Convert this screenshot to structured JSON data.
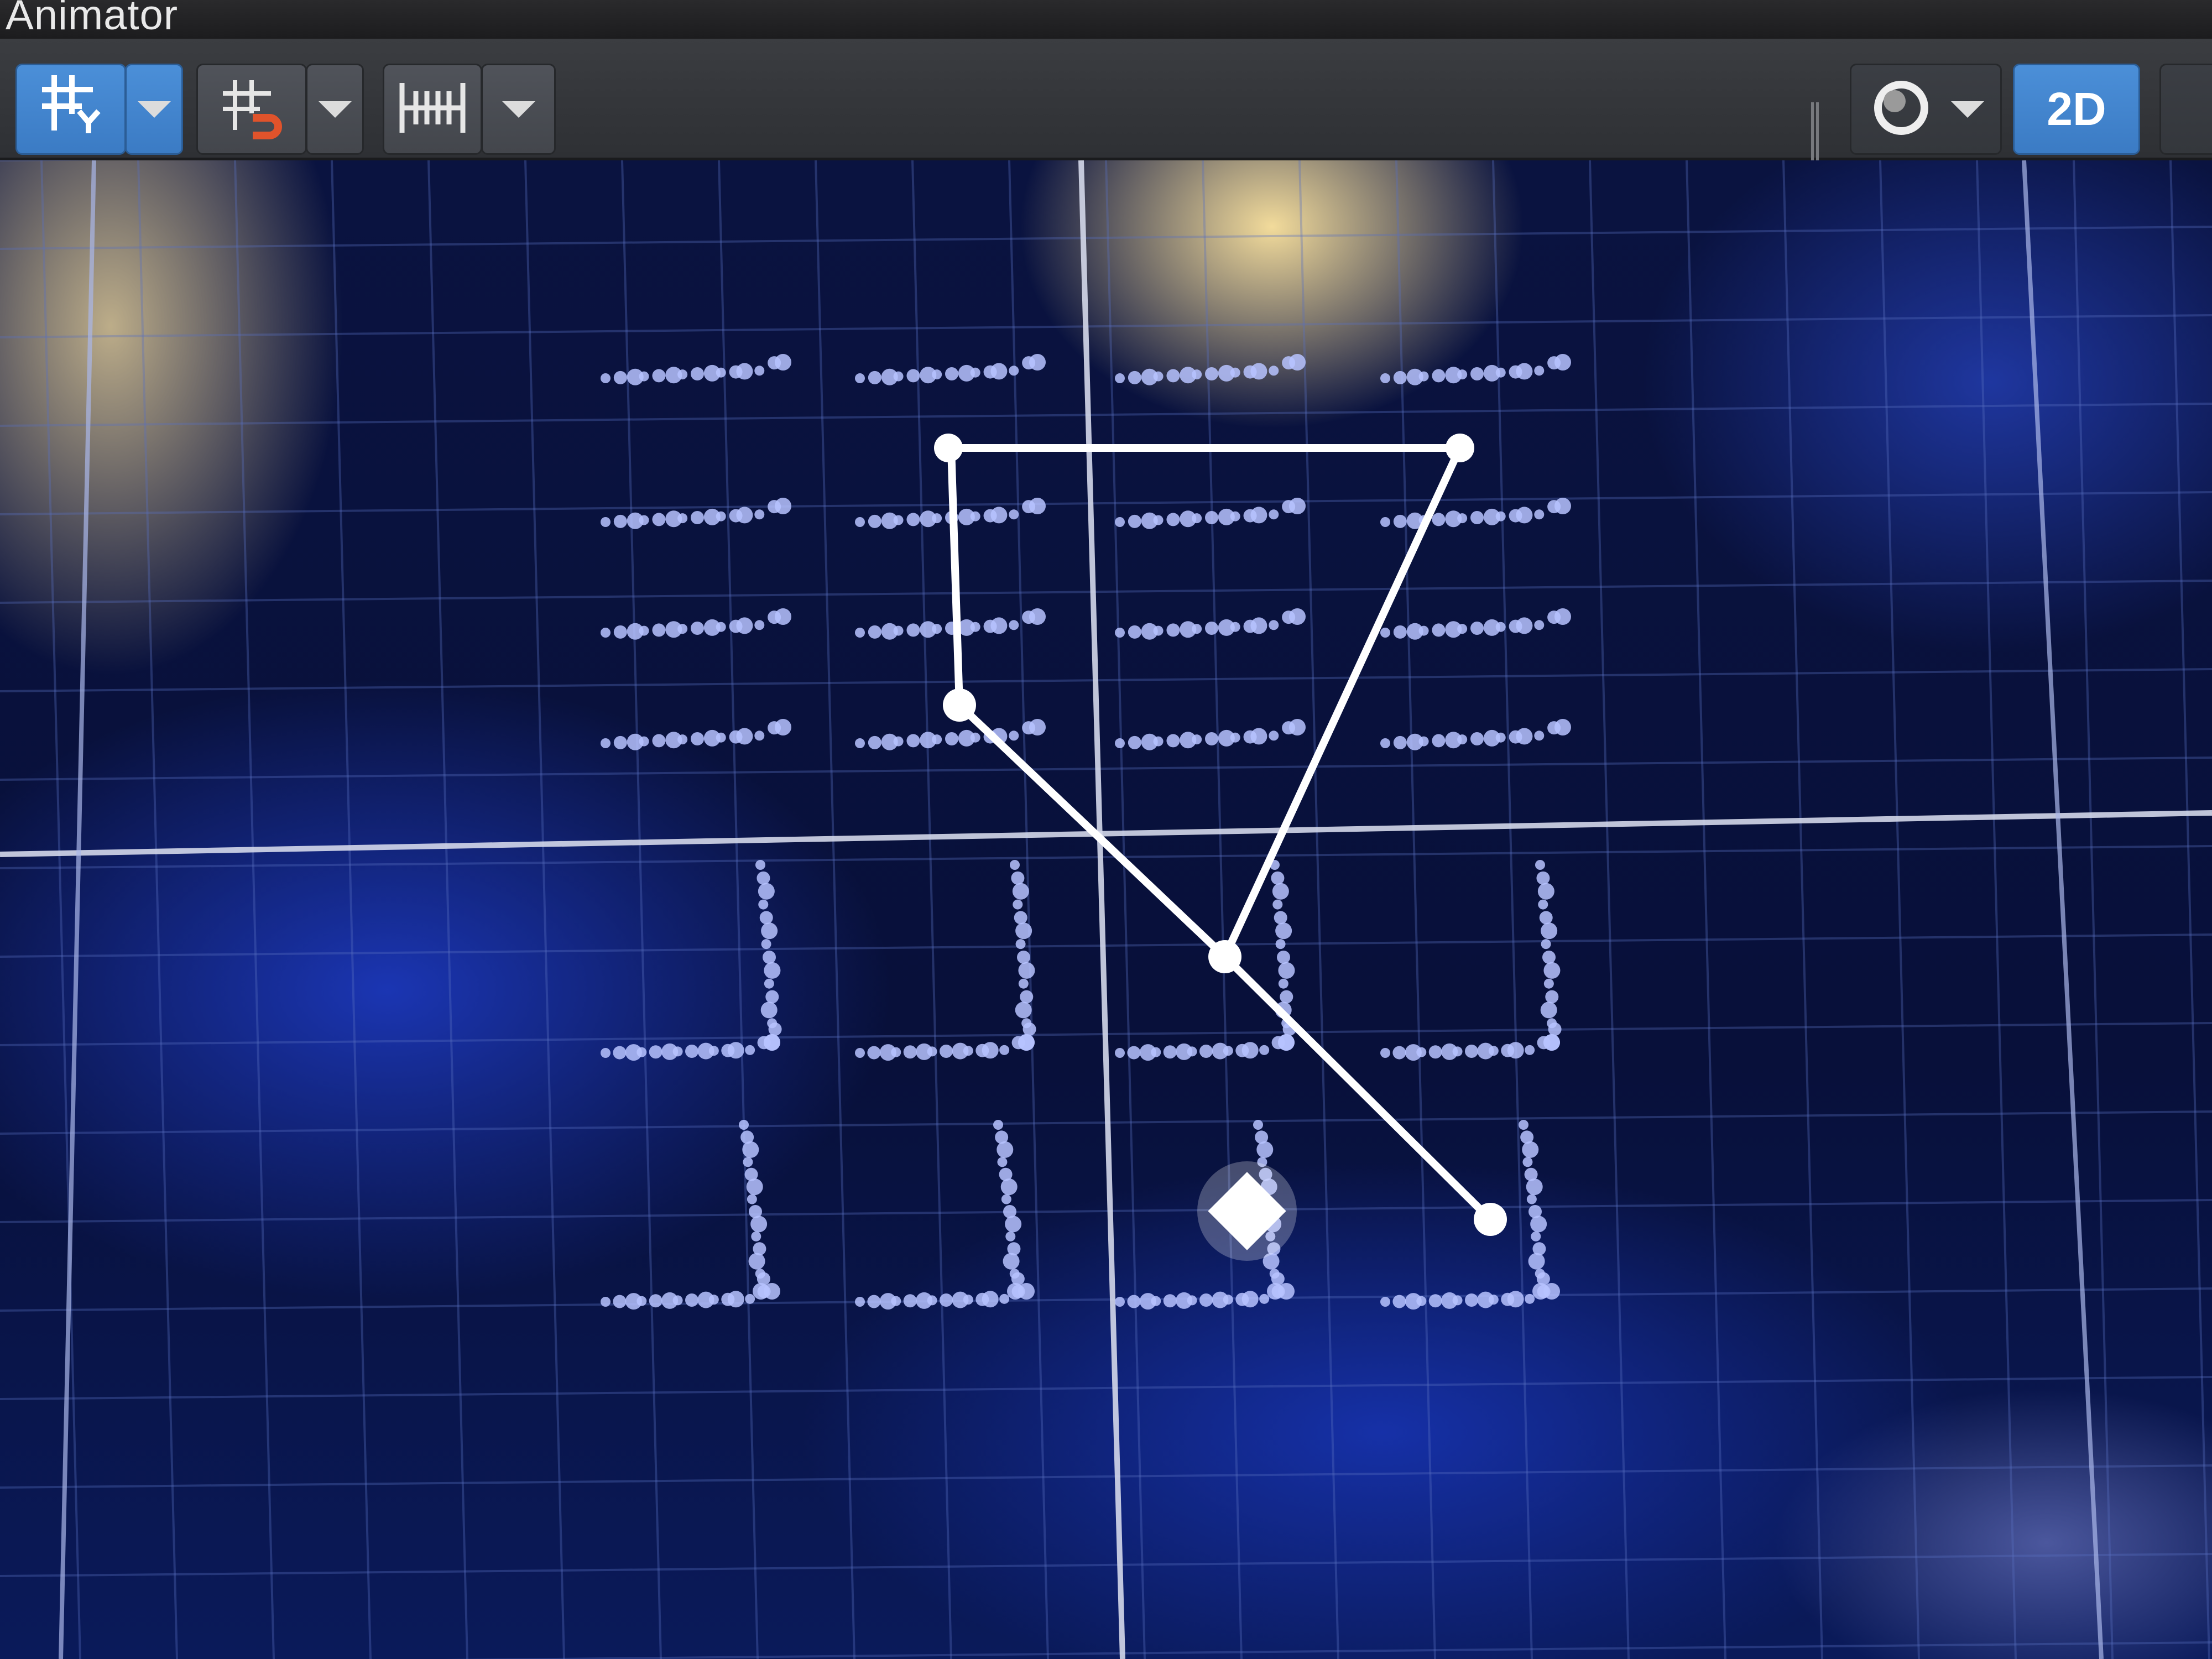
{
  "window": {
    "title": "Animator"
  },
  "toolbar": {
    "left_buttons": [
      {
        "name": "grid-y-button",
        "icon": "grid-y-icon",
        "glyph": "#Y",
        "active": true
      },
      {
        "name": "grid-y-dropdown",
        "icon": "chevron-down-icon",
        "active": true
      },
      {
        "name": "snap-button",
        "icon": "magnet-grid-icon",
        "glyph": "#",
        "active": false
      },
      {
        "name": "snap-dropdown",
        "icon": "chevron-down-icon",
        "active": false
      },
      {
        "name": "timeline-button",
        "icon": "timeline-icon",
        "glyph": "|+|",
        "active": false
      },
      {
        "name": "timeline-dropdown",
        "icon": "chevron-down-icon",
        "active": false
      }
    ],
    "right_buttons": [
      {
        "name": "shading-mode-button",
        "icon": "circle-icon",
        "active": false
      },
      {
        "name": "2d-toggle-button",
        "label": "2D",
        "active": true
      }
    ]
  },
  "viewport": {
    "grid": {
      "visible": true,
      "line_color": "#5a6fc0",
      "axis_color": "#d4d8ea"
    },
    "background_colors": [
      "#0a1340",
      "#1e3cc8",
      "#ffe6a0"
    ],
    "pattern_path": {
      "color": "#ffffff",
      "nodes": [
        "node-1",
        "node-2",
        "node-3",
        "node-4",
        "node-5"
      ],
      "segments": 4
    },
    "glyph_tile_color": "#b7c3ff",
    "cursor_marker_color": "#ffffff"
  }
}
